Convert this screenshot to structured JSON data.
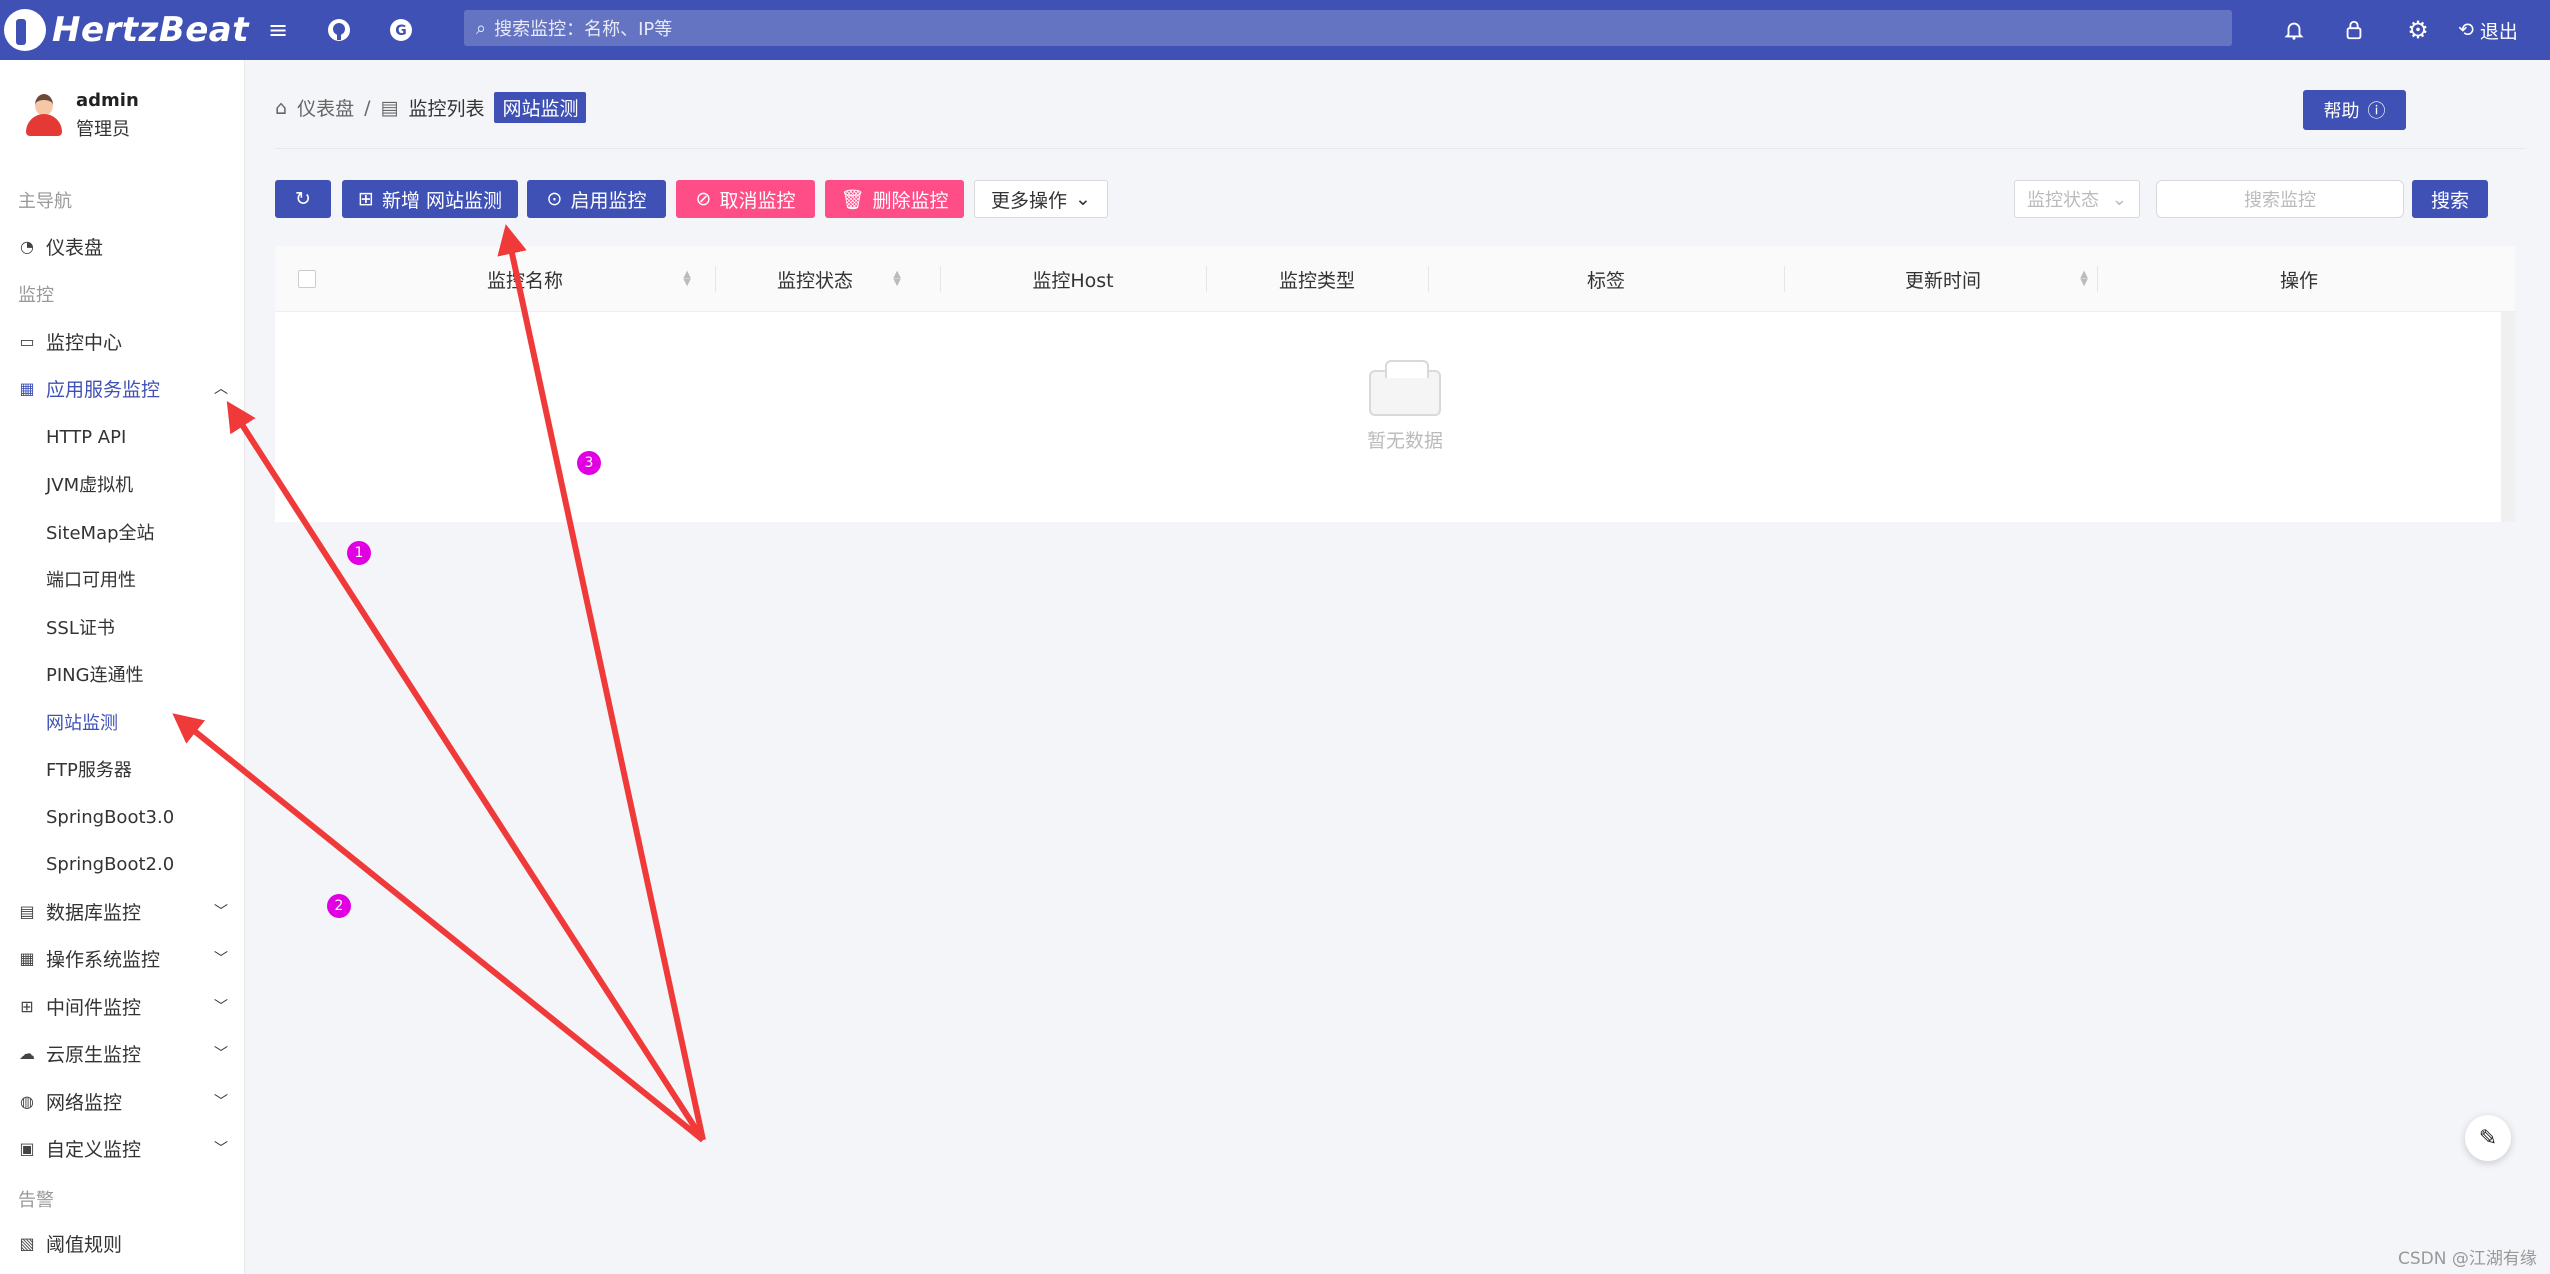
{
  "topbar": {
    "logo_text": "HertzBeat",
    "search_placeholder": "搜索监控：名称、IP等",
    "logout_label": "退出",
    "icons": [
      "menu-icon",
      "github-icon",
      "gitee-icon",
      "bell-icon",
      "lock-icon",
      "settings-icon",
      "logout-icon"
    ]
  },
  "user": {
    "name": "admin",
    "role": "管理员"
  },
  "sidebar": {
    "group_main": "主导航",
    "dashboard": "仪表盘",
    "group_monitor": "监控",
    "monitor_center": "监控中心",
    "app_service": "应用服务监控",
    "sub_items": [
      "HTTP API",
      "JVM虚拟机",
      "SiteMap全站",
      "端口可用性",
      "SSL证书",
      "PING连通性",
      "网站监测",
      "FTP服务器",
      "SpringBoot3.0",
      "SpringBoot2.0"
    ],
    "active_sub": "网站监测",
    "database": "数据库监控",
    "os": "操作系统监控",
    "middleware": "中间件监控",
    "cloud_native": "云原生监控",
    "network": "网络监控",
    "custom": "自定义监控",
    "group_alert": "告警",
    "threshold": "阈值规则"
  },
  "breadcrumb": {
    "home": "仪表盘",
    "list": "监控列表",
    "current": "网站监测"
  },
  "help_label": "帮助",
  "toolbar": {
    "add_label": "新增 网站监测",
    "enable_label": "启用监控",
    "cancel_label": "取消监控",
    "delete_label": "删除监控",
    "more_label": "更多操作",
    "status_placeholder": "监控状态",
    "search_placeholder": "搜索监控",
    "search_label": "搜索"
  },
  "table": {
    "columns": [
      "监控名称",
      "监控状态",
      "监控Host",
      "监控类型",
      "标签",
      "更新时间",
      "操作"
    ],
    "empty_text": "暂无数据"
  },
  "annotations": {
    "markers": [
      "1",
      "2",
      "3"
    ],
    "arrow_color": "#f03a3a",
    "marker_color": "#e100e1"
  },
  "watermark": "CSDN @江湖有缘",
  "colors": {
    "primary": "#3f51b5",
    "danger": "#ff4d88"
  }
}
